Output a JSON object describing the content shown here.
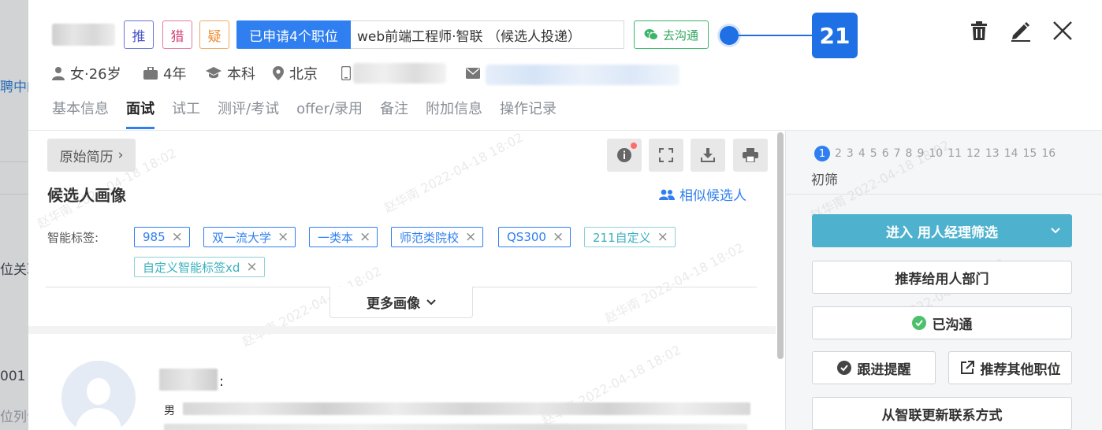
{
  "backdrop": {
    "texts": [
      "聘中的",
      "位关耶",
      "001",
      "位列诗"
    ]
  },
  "header": {
    "badges": {
      "recommend": "推",
      "hunter": "猎",
      "doubt": "疑"
    },
    "applied_label": "已申请4个职位",
    "job_selected": "web前端工程师·智联 （候选人投递）",
    "chat_button": "去沟通",
    "annotation_number": "21",
    "icons": [
      "trash-icon",
      "edit-icon",
      "close-icon"
    ]
  },
  "meta": {
    "gender_age": "女·26岁",
    "experience": "4年",
    "education": "本科",
    "location": "北京"
  },
  "tabs": [
    "基本信息",
    "面试",
    "试工",
    "测评/考试",
    "offer/录用",
    "备注",
    "附加信息",
    "操作记录"
  ],
  "active_tab": "面试",
  "main": {
    "resume_button": "原始简历",
    "section_title": "候选人画像",
    "similar_candidates": "相似候选人",
    "tag_label": "智能标签:",
    "tags": [
      {
        "label": "985",
        "style": "blue"
      },
      {
        "label": "双一流大学",
        "style": "blue"
      },
      {
        "label": "一类本",
        "style": "blue"
      },
      {
        "label": "师范类院校",
        "style": "blue"
      },
      {
        "label": "QS300",
        "style": "blue"
      },
      {
        "label": "211自定义",
        "style": "cyan"
      },
      {
        "label": "自定义智能标签xd",
        "style": "cyan"
      }
    ],
    "more_portrait": "更多画像",
    "gender_short": "男",
    "watermark": "赵华南 2022-04-18 18:02"
  },
  "side": {
    "steps": [
      "1",
      "2",
      "3",
      "4",
      "5",
      "6",
      "7",
      "8",
      "9",
      "10",
      "11",
      "12",
      "13",
      "14",
      "15",
      "16"
    ],
    "current_step_name": "初筛",
    "primary_action": "进入 用人经理筛选",
    "actions": {
      "recommend_dept": "推荐给用人部门",
      "contacted": "已沟通",
      "follow_up": "跟进提醒",
      "recommend_other": "推荐其他职位",
      "update_contact": "从智联更新联系方式"
    }
  },
  "colors": {
    "primary": "#2f7ff0",
    "teal": "#4eb2cf",
    "green": "#3bb56a",
    "annotation": "#1f6fe5"
  }
}
